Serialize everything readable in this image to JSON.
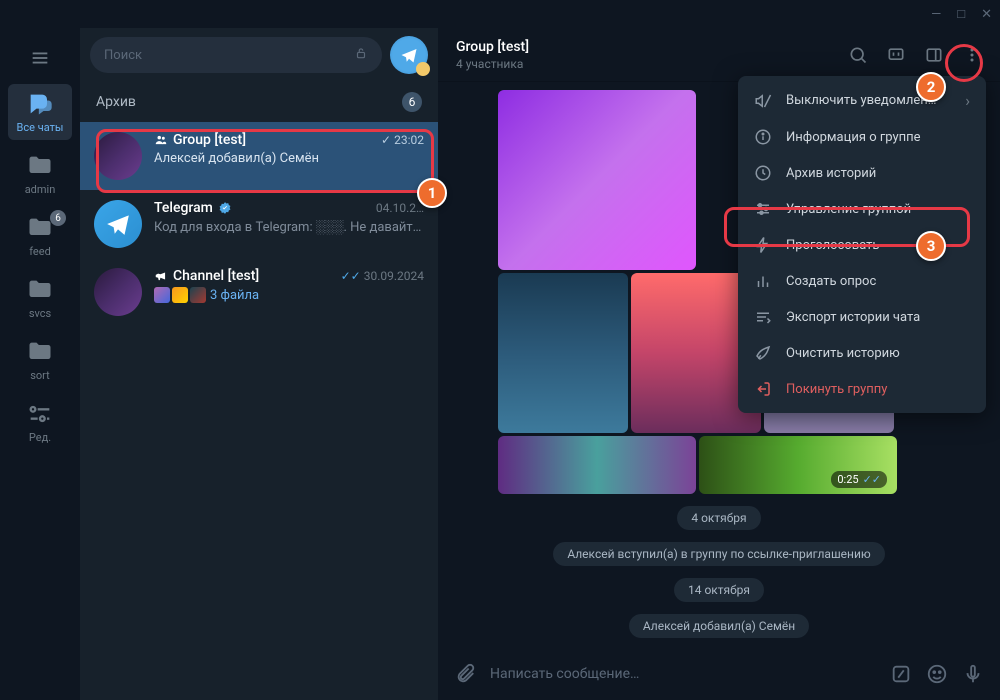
{
  "window": {
    "min": "—",
    "max": "□",
    "close": "✕"
  },
  "rail": {
    "all_chats": "Все чаты",
    "admin": "admin",
    "feed": "feed",
    "feed_badge": "6",
    "svcs": "svcs",
    "sort": "sort",
    "edit": "Ред."
  },
  "search": {
    "placeholder": "Поиск"
  },
  "archive": {
    "label": "Архив",
    "count": "6"
  },
  "chats": [
    {
      "name": "Group [test]",
      "msg": "Алексей добавил(а) Семён",
      "time": "23:02",
      "check": "✓"
    },
    {
      "name": "Telegram",
      "msg": "Код для входа в Telegram: ░░░. Не давайт…",
      "time": "04.10.2…"
    },
    {
      "name": "Channel [test]",
      "msg": "3 файла",
      "time": "30.09.2024",
      "check": "✓✓"
    }
  ],
  "header": {
    "title": "Group [test]",
    "sub": "4 участника"
  },
  "menu": [
    {
      "label": "Выключить уведомлен…",
      "chev": "›"
    },
    {
      "label": "Информация о группе"
    },
    {
      "label": "Архив историй"
    },
    {
      "label": "Управление группой"
    },
    {
      "label": "Проголосовать"
    },
    {
      "label": "Создать опрос"
    },
    {
      "label": "Экспорт истории чата"
    },
    {
      "label": "Очистить историю"
    },
    {
      "label": "Покинуть группу"
    }
  ],
  "video_duration": "0:25",
  "dates": {
    "d1": "4 октября",
    "d2": "14 октября"
  },
  "sys": {
    "s1": "Алексей вступил(а) в группу по ссылке-приглашению",
    "s2": "Алексей добавил(а) Семён"
  },
  "composer": {
    "placeholder": "Написать сообщение…"
  },
  "callouts": {
    "c1": "1",
    "c2": "2",
    "c3": "3"
  }
}
